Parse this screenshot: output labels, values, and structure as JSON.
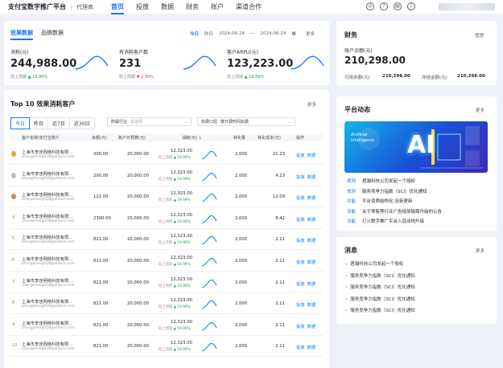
{
  "header": {
    "brand": "支付宝数字推广平台",
    "role": "代理商",
    "nav": [
      "首页",
      "投放",
      "数据",
      "财务",
      "账户",
      "渠道合作"
    ],
    "active_nav": 0
  },
  "effect": {
    "tabs": [
      "效果数据",
      "品牌数据"
    ],
    "date_tabs": [
      "今日",
      "昨日"
    ],
    "date_from": "2024-06-24",
    "date_to": "2024-06-24",
    "date_sep": "—",
    "more": "更多",
    "kpis": [
      {
        "label": "消耗(元)",
        "value": "244,988.00",
        "compare": "较上周期",
        "change": "19.99%",
        "dir": "up"
      },
      {
        "label": "有消耗客户数",
        "value": "231",
        "compare": "较上周期",
        "change": "2.99%",
        "dir": "down"
      },
      {
        "label": "客户ARPU(元)",
        "value": "123,223.00",
        "compare": "较上周期",
        "change": "19.99%",
        "dir": "up"
      }
    ]
  },
  "top10": {
    "title": "Top 10 效果消耗客户",
    "more": "更多",
    "filters": [
      "今日",
      "昨日",
      "近7日",
      "近30日"
    ],
    "industry_label": "所属行业",
    "industry_placeholder": "请选择",
    "sort_label": "扣费口径",
    "sort_value": "按计费时间扣费",
    "headers": [
      "客户名称/支付宝账户",
      "余额(元)",
      "账户日预算(元)",
      "消耗(元)",
      "转化量",
      "转化成本(元)",
      "操作"
    ],
    "rows": [
      {
        "rank": "1",
        "name": "上海市李佳网络科技有限...",
        "account": "zhongzheng028@alitest.com",
        "balance": "300.00",
        "budget": "20,000.00",
        "cost": "12,323.00",
        "compare": "较上周期",
        "change": "19.99%",
        "conv": "2,000",
        "cpa": "21.23"
      },
      {
        "rank": "2",
        "name": "上海市李佳网络科技有限...",
        "account": "zhongzheng028@alitest.com",
        "balance": "200.00",
        "budget": "20,000.00",
        "cost": "12,323.00",
        "compare": "较上周期",
        "change": "19.99%",
        "conv": "2,000",
        "cpa": "4.23"
      },
      {
        "rank": "3",
        "name": "上海市李佳网络科技有限...",
        "account": "zhongzheng028@alitest.com",
        "balance": "122.00",
        "budget": "20,000.00",
        "cost": "12,323.00",
        "compare": "较上周期",
        "change": "19.99%",
        "conv": "2,000",
        "cpa": "12.09"
      },
      {
        "rank": "4",
        "name": "上海市李佳网络科技有限...",
        "account": "zhongzheng028@alitest.com",
        "balance": "2300.00",
        "budget": "20,000.00",
        "cost": "12,323.00",
        "compare": "较上周期",
        "change": "19.99%",
        "conv": "2,000",
        "cpa": "8.42"
      },
      {
        "rank": "5",
        "name": "上海市李佳网络科技有限...",
        "account": "zhongzheng028@alitest.com",
        "balance": "821.00",
        "budget": "20,000.00",
        "cost": "12,323.00",
        "compare": "较上周期",
        "change": "19.99%",
        "conv": "2,000",
        "cpa": "2.11"
      },
      {
        "rank": "6",
        "name": "上海市李佳网络科技有限...",
        "account": "zhongzheng028@alitest.com",
        "balance": "821.00",
        "budget": "20,000.00",
        "cost": "12,323.00",
        "compare": "较上周期",
        "change": "19.99%",
        "conv": "2,000",
        "cpa": "2.11"
      },
      {
        "rank": "7",
        "name": "上海市李佳网络科技有限...",
        "account": "zhongzheng028@alitest.com",
        "balance": "821.00",
        "budget": "20,000.00",
        "cost": "12,323.00",
        "compare": "较上周期",
        "change": "19.99%",
        "conv": "2,000",
        "cpa": "2.11"
      },
      {
        "rank": "8",
        "name": "上海市李佳网络科技有限...",
        "account": "zhongzheng028@alitest.com",
        "balance": "821.00",
        "budget": "20,000.00",
        "cost": "12,323.00",
        "compare": "较上周期",
        "change": "19.99%",
        "conv": "2,000",
        "cpa": "2.11"
      },
      {
        "rank": "9",
        "name": "上海市李佳网络科技有限...",
        "account": "zhongzheng028@alitest.com",
        "balance": "821.00",
        "budget": "20,000.00",
        "cost": "12,323.00",
        "compare": "较上周期",
        "change": "19.99%",
        "conv": "2,000",
        "cpa": "2.11"
      },
      {
        "rank": "10",
        "name": "上海市李佳网络科技有限...",
        "account": "zhongzheng028@alitest.com",
        "balance": "821.00",
        "budget": "20,000.00",
        "cost": "12,323.00",
        "compare": "较上周期",
        "change": "19.99%",
        "conv": "2,000",
        "cpa": "2.11"
      }
    ],
    "actions": [
      "投放",
      "数据"
    ]
  },
  "finance": {
    "title": "财务",
    "manage": "管理",
    "balance_label": "账户余额(元)",
    "balance": "210,298.00",
    "available_label": "可用余额(元)",
    "available": "210,298.00",
    "frozen_label": "冻结金额(元)",
    "frozen": "210,298.00"
  },
  "platform": {
    "title": "平台动态",
    "more": "更多",
    "banner_text_1": "Artificial",
    "banner_text_2": "Intelligence",
    "banner_ai": "AI",
    "news": [
      {
        "tag": "规则",
        "text": "君瀚科技公司发起一个授权"
      },
      {
        "tag": "规则",
        "text": "服务竞争力指数（SCI）优化通知"
      },
      {
        "tag": "功能",
        "text": "平台资质结构化-全新更新"
      },
      {
        "tag": "功能",
        "text": "关于零售等行业广告投放链路升级的公告"
      },
      {
        "tag": "功能",
        "text": "灯火数字推广平台入驻动线升级"
      }
    ]
  },
  "messages": {
    "title": "消息",
    "more": "更多",
    "items": [
      "君瀚科技公司发起一个授权",
      "服务竞争力指数（SCI）优化通知",
      "服务竞争力指数（SCI）优化通知",
      "服务竞争力指数（SCI）优化通知",
      "服务竞争力指数（SCI）优化通知"
    ]
  },
  "colors": {
    "accent": "#1677ff",
    "up": "#16a34a",
    "down": "#e5484d",
    "medal_gold": "#e6a23c",
    "medal_silver": "#b8bec8",
    "medal_bronze": "#c98a54"
  }
}
